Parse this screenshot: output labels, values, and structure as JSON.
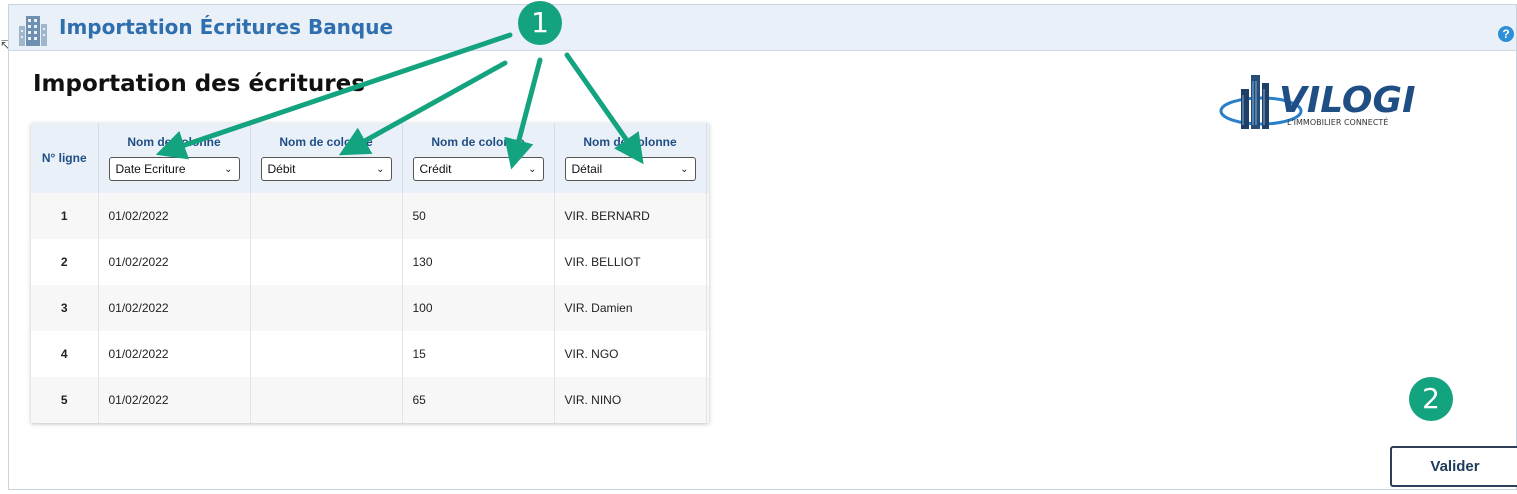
{
  "window": {
    "title": "Importation Écritures Banque"
  },
  "page": {
    "title": "Importation des écritures"
  },
  "logo": {
    "brand": "VILOGI",
    "tagline": "L'IMMOBILIER CONNECTÉ"
  },
  "help_icon": "?",
  "table": {
    "row_header": "N° ligne",
    "columns": [
      {
        "header": "Nom de colonne",
        "selected": "Date Ecriture"
      },
      {
        "header": "Nom de colonne",
        "selected": "Débit"
      },
      {
        "header": "Nom de colonne",
        "selected": "Crédit"
      },
      {
        "header": "Nom de colonne",
        "selected": "Détail"
      }
    ],
    "rows": [
      {
        "num": "1",
        "cells": [
          "01/02/2022",
          "",
          "50",
          "VIR. BERNARD"
        ]
      },
      {
        "num": "2",
        "cells": [
          "01/02/2022",
          "",
          "130",
          "VIR. BELLIOT"
        ]
      },
      {
        "num": "3",
        "cells": [
          "01/02/2022",
          "",
          "100",
          "VIR. Damien"
        ]
      },
      {
        "num": "4",
        "cells": [
          "01/02/2022",
          "",
          "15",
          "VIR. NGO"
        ]
      },
      {
        "num": "5",
        "cells": [
          "01/02/2022",
          "",
          "65",
          "VIR. NINO"
        ]
      }
    ]
  },
  "annotations": {
    "badge_1": "1",
    "badge_2": "2"
  },
  "actions": {
    "validate_label": "Valider"
  },
  "colors": {
    "accent": "#2f6fae",
    "badge": "#14a37f",
    "header_bg": "#e9f0f8"
  }
}
